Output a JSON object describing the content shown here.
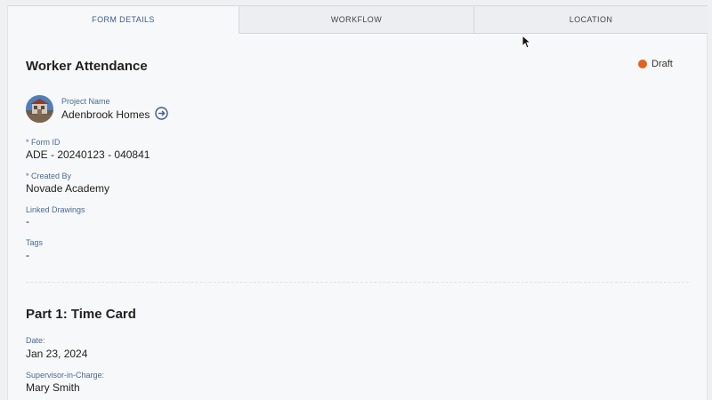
{
  "tabs": [
    {
      "label": "FORM DETAILS",
      "active": true
    },
    {
      "label": "WORKFLOW",
      "active": false
    },
    {
      "label": "LOCATION",
      "active": false
    }
  ],
  "form": {
    "title": "Worker Attendance",
    "status": "Draft",
    "status_color": "#e2651f"
  },
  "fields": {
    "project_name_label": "Project Name",
    "project_name_value": "Adenbrook Homes",
    "form_id_label": "* Form ID",
    "form_id_value": "ADE - 20240123 - 040841",
    "created_by_label": "* Created By",
    "created_by_value": "Novade Academy",
    "linked_drawings_label": "Linked Drawings",
    "linked_drawings_value": "-",
    "tags_label": "Tags",
    "tags_value": "-"
  },
  "part1": {
    "title": "Part 1: Time Card",
    "date_label": "Date:",
    "date_value": "Jan 23, 2024",
    "supervisor_label": "Supervisor-in-Charge:",
    "supervisor_value": "Mary Smith"
  },
  "icons": {
    "project_link": "arrow-circle-right-icon",
    "cursor": "mouse-pointer-icon"
  }
}
